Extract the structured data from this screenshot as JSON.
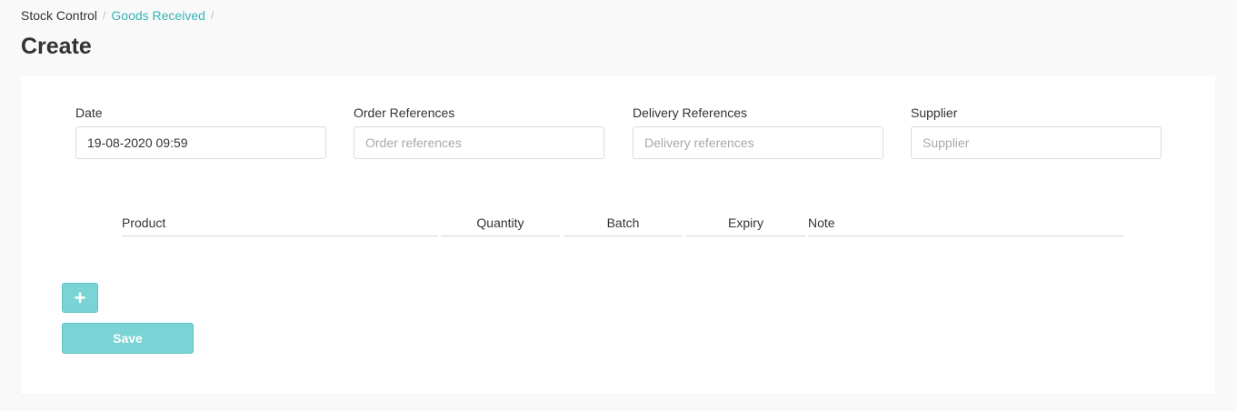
{
  "breadcrumb": {
    "root": "Stock Control",
    "separator": "/",
    "link": "Goods Received"
  },
  "page_title": "Create",
  "form": {
    "date": {
      "label": "Date",
      "value": "19-08-2020 09:59",
      "placeholder": ""
    },
    "order_references": {
      "label": "Order References",
      "value": "",
      "placeholder": "Order references"
    },
    "delivery_references": {
      "label": "Delivery References",
      "value": "",
      "placeholder": "Delivery references"
    },
    "supplier": {
      "label": "Supplier",
      "value": "",
      "placeholder": "Supplier"
    }
  },
  "table": {
    "columns": [
      "Product",
      "Quantity",
      "Batch",
      "Expiry",
      "Note"
    ]
  },
  "buttons": {
    "add_label": "+",
    "save_label": "Save"
  },
  "colors": {
    "accent": "#7ad3d4",
    "link": "#36b4b5",
    "background": "#f9f9f9"
  }
}
